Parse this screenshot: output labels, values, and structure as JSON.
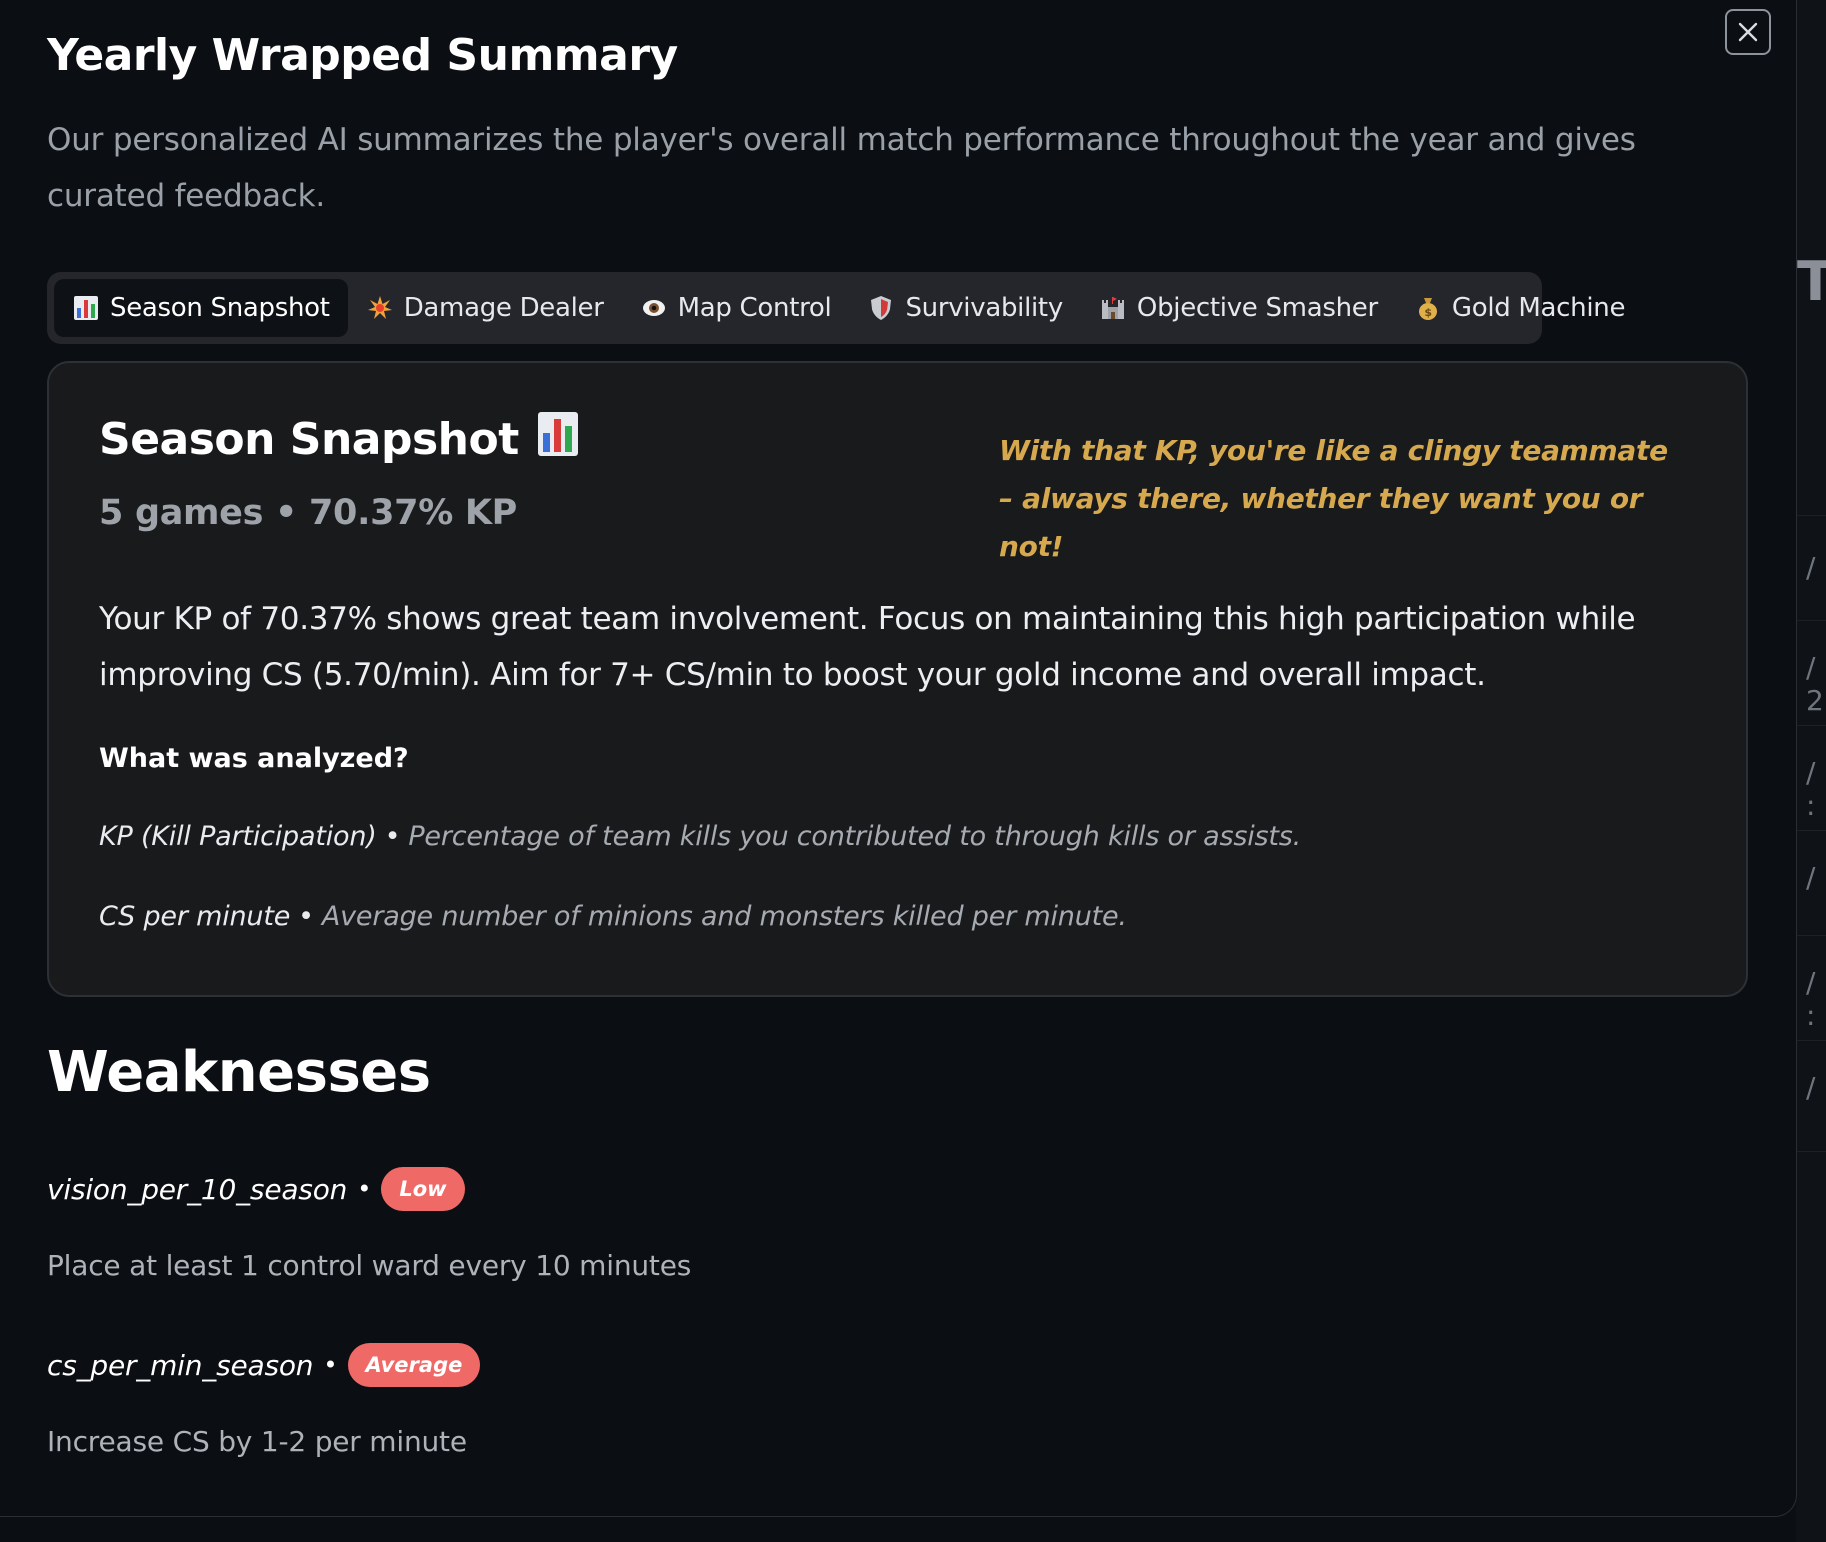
{
  "modal": {
    "title": "Yearly Wrapped Summary",
    "description": "Our personalized AI summarizes the player's overall match performance throughout the year and gives curated feedback.",
    "close_icon": "close-icon"
  },
  "tabs": [
    {
      "label": "Season Snapshot",
      "icon": "bar-chart-icon",
      "active": true
    },
    {
      "label": "Damage Dealer",
      "icon": "explosion-icon",
      "active": false
    },
    {
      "label": "Map Control",
      "icon": "eye-icon",
      "active": false
    },
    {
      "label": "Survivability",
      "icon": "shield-icon",
      "active": false
    },
    {
      "label": "Objective Smasher",
      "icon": "castle-icon",
      "active": false
    },
    {
      "label": "Gold Machine",
      "icon": "money-bag-icon",
      "active": false
    }
  ],
  "snapshot": {
    "title": "Season Snapshot",
    "subtitle": "5 games • 70.37% KP",
    "quip": "With that KP, you're like a clingy teammate – always there, whether they want you or not!",
    "summary": "Your KP of 70.37% shows great team involvement. Focus on maintaining this high participation while improving CS (5.70/min). Aim for 7+ CS/min to boost your gold income and overall impact.",
    "analyzed_heading": "What was analyzed?",
    "metrics": [
      {
        "name": "KP (Kill Participation)",
        "separator": "•",
        "description": "Percentage of team kills you contributed to through kills or assists."
      },
      {
        "name": "CS per minute",
        "separator": "•",
        "description": "Average number of minions and monsters killed per minute."
      }
    ]
  },
  "weaknesses": {
    "title": "Weaknesses",
    "items": [
      {
        "name": "vision_per_10_season",
        "separator": "•",
        "badge": "Low",
        "advice": "Place at least 1 control ward every 10 minutes"
      },
      {
        "name": "cs_per_min_season",
        "separator": "•",
        "badge": "Average",
        "advice": "Increase CS by 1-2 per minute"
      }
    ]
  },
  "background": {
    "letter": "T",
    "slashes": [
      "/",
      "/ 2",
      "/ :",
      "/",
      "/ :",
      "/"
    ]
  },
  "colors": {
    "background": "#0b0e12",
    "card": "#191a1c",
    "tab_bar": "#24262b",
    "quip": "#d7a94e",
    "badge": "#ef6a67"
  }
}
